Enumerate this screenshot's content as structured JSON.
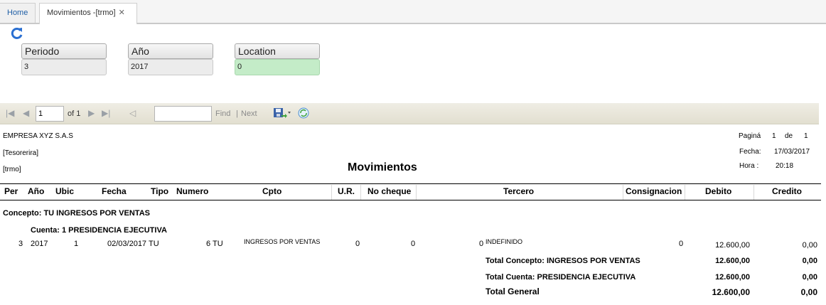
{
  "tabs": [
    {
      "label": "Home"
    },
    {
      "label": "Movimientos -[trmo]"
    }
  ],
  "params": {
    "periodo": {
      "label": "Periodo",
      "value": "3"
    },
    "anio": {
      "label": "Año",
      "value": "2017"
    },
    "location": {
      "label": "Location",
      "value": "0"
    }
  },
  "toolbar": {
    "page_value": "1",
    "of_text": "of 1",
    "find_label": "Find",
    "separator": "|",
    "next_label": "Next"
  },
  "report": {
    "company": "EMPRESA XYZ S.A.S",
    "department": "[Tesorerira]",
    "code": "[trmo]",
    "title": "Movimientos",
    "pagina_label": "Paginá",
    "pagina_num": "1",
    "de_label": "de",
    "pagina_total": "1",
    "fecha_label": "Fecha:",
    "fecha_value": "17/03/2017",
    "hora_label": "Hora :",
    "hora_value": "20:18",
    "columns": [
      "Per",
      "Año",
      "Ubic",
      "Fecha",
      "Tipo",
      "Numero",
      "Cpto",
      "U.R.",
      "No cheque",
      "Tercero",
      "Consignacion",
      "Debito",
      "Credito"
    ],
    "concepto_header": "Concepto: TU  INGRESOS POR VENTAS",
    "cuenta_header": "Cuenta: 1 PRESIDENCIA EJECUTIVA",
    "row": {
      "per": "3",
      "anio": "2017",
      "ubic": "1",
      "fecha": "02/03/2017",
      "tipo": "TU",
      "numero": "6 TU",
      "cpto": "INGRESOS POR VENTAS",
      "ur": "0",
      "nocheque": "0",
      "tercero_code": "0",
      "tercero": "INDEFINIDO",
      "consignacion": "0",
      "debito": "12.600,00",
      "credito": "0,00"
    },
    "totals": [
      {
        "label": "Total Concepto: INGRESOS POR VENTAS",
        "debito": "12.600,00",
        "credito": "0,00"
      },
      {
        "label": "Total Cuenta: PRESIDENCIA EJECUTIVA",
        "debito": "12.600,00",
        "credito": "0,00"
      },
      {
        "label": "Total General",
        "debito": "12.600,00",
        "credito": "0,00"
      }
    ]
  },
  "colors": {
    "link_blue": "#1f5fa6",
    "location_green": "#c4ecc8",
    "toolbar_tan": "#e8e5d8"
  }
}
